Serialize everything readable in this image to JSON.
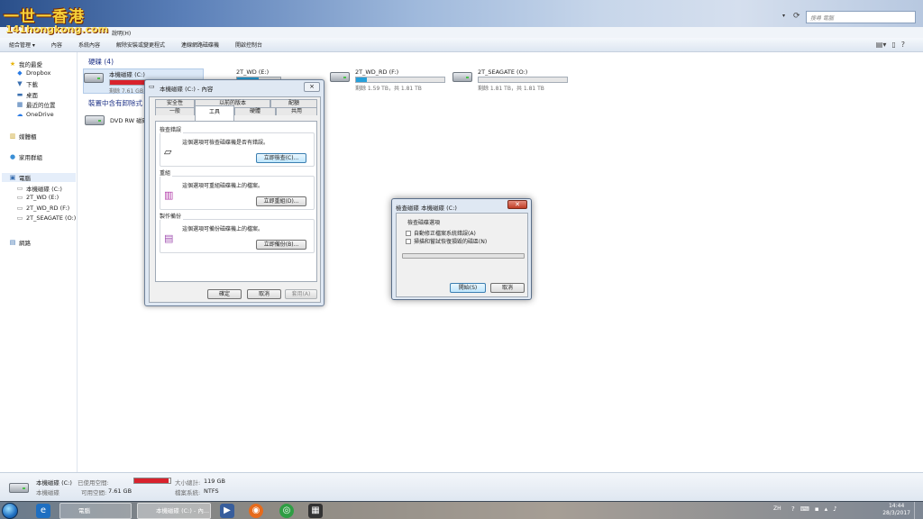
{
  "window": {
    "search_placeholder": "搜尋 電腦",
    "menu_help": "說明(H)",
    "toolbar": [
      "組合管理 ▾",
      "內容",
      "系統內容",
      "解除安裝或變更程式",
      "連線網路磁碟機",
      "開啟控制台"
    ]
  },
  "watermark": {
    "line1": "一世一香港",
    "line2": "141hongkong.com"
  },
  "nav": {
    "favorites": "我的最愛",
    "dropbox": "Dropbox",
    "downloads": "下載",
    "desktop": "桌面",
    "recent": "最近的位置",
    "onedrive": "OneDrive",
    "libraries": "媒體櫃",
    "homegroup": "家用群組",
    "computer": "電腦",
    "drive_c": "本機磁碟 (C:)",
    "drive_e": "2T_WD (E:)",
    "drive_f": "2T_WD_RD (F:)",
    "drive_o": "2T_SEAGATE (O:)",
    "network": "網路"
  },
  "content": {
    "hdd_header": "硬碟 (4)",
    "removable_header": "裝置中含有卸除式",
    "drives": [
      {
        "name": "本機磁碟 (C:)",
        "free": "剩餘 7.61 GB",
        "fill": 0.94,
        "color": "#d9222c"
      },
      {
        "name": "2T_WD (E:)",
        "free": "",
        "fill": 0.5,
        "color": "#26a0da"
      },
      {
        "name": "2T_WD_RD (F:)",
        "free": "剩餘 1.59 TB，共 1.81 TB",
        "fill": 0.12,
        "color": "#26a0da"
      },
      {
        "name": "2T_SEAGATE (O:)",
        "free": "剩餘 1.81 TB，共 1.81 TB",
        "fill": 0.0,
        "color": "#26a0da"
      }
    ],
    "dvd": "DVD RW 磁碟"
  },
  "prop_dialog": {
    "title": "本機磁碟 (C:) - 內容",
    "tabs_row1": [
      "安全性",
      "以前的版本",
      "配額"
    ],
    "tabs_row2": [
      "一般",
      "工具",
      "硬體",
      "共用"
    ],
    "group1": {
      "label": "檢查錯誤",
      "text": "這個選項可檢查磁碟機是否有錯誤。",
      "button": "立即檢查(C)..."
    },
    "group2": {
      "label": "重組",
      "text": "這個選項可重組磁碟機上的檔案。",
      "button": "立即重組(D)..."
    },
    "group3": {
      "label": "製作備份",
      "text": "這個選項可備份磁碟機上的檔案。",
      "button": "立即備份(B)..."
    },
    "ok": "確定",
    "cancel": "取消",
    "apply": "套用(A)"
  },
  "chk_dialog": {
    "title": "檢查磁碟 本機磁碟 (C:)",
    "group_label": "檢查磁碟選項",
    "opt1": "自動修正檔案系統錯誤(A)",
    "opt2": "掃描和嘗試恢復損毀的磁區(N)",
    "start": "開始(S)",
    "cancel": "取消"
  },
  "details": {
    "drive_name": "本機磁碟 (C:)",
    "drive_type": "本機磁碟",
    "used_label": "已使用空間:",
    "free_label": "可用空間:",
    "free_value": "7.61 GB",
    "used_fill": 0.94,
    "total_label": "大小總計:",
    "total_value": "119 GB",
    "fs_label": "檔案系統:",
    "fs_value": "NTFS"
  },
  "taskbar": {
    "task1": "電腦",
    "task2": "本機磁碟 (C:) - 內...",
    "lang": "ZH",
    "time": "14:44",
    "date": "28/3/2017"
  },
  "colors": {
    "accent": "#26a0da",
    "c_drive_bar": "#d9222c"
  }
}
